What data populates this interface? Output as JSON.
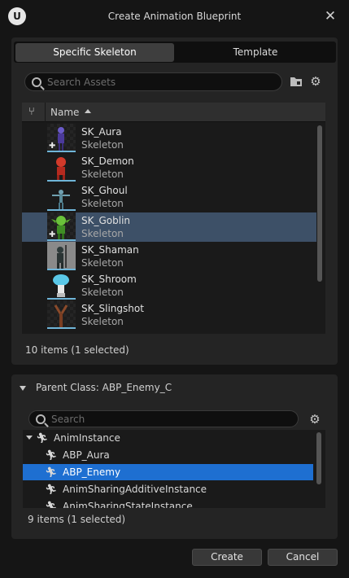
{
  "window": {
    "title": "Create Animation Blueprint",
    "logo_text": "U",
    "close_glyph": "✕"
  },
  "tabs": [
    {
      "label": "Specific Skeleton",
      "active": true
    },
    {
      "label": "Template",
      "active": false
    }
  ],
  "asset_search": {
    "placeholder": "Search Assets",
    "value": ""
  },
  "asset_list": {
    "column_header": "Name",
    "items": [
      {
        "name": "SK_Aura",
        "type": "Skeleton",
        "icon": "aura-character-thumbnail",
        "selected": false
      },
      {
        "name": "SK_Demon",
        "type": "Skeleton",
        "icon": "demon-character-thumbnail",
        "selected": false
      },
      {
        "name": "SK_Ghoul",
        "type": "Skeleton",
        "icon": "ghoul-character-thumbnail",
        "selected": false
      },
      {
        "name": "SK_Goblin",
        "type": "Skeleton",
        "icon": "goblin-character-thumbnail",
        "selected": true
      },
      {
        "name": "SK_Shaman",
        "type": "Skeleton",
        "icon": "shaman-character-thumbnail",
        "selected": false
      },
      {
        "name": "SK_Shroom",
        "type": "Skeleton",
        "icon": "shroom-character-thumbnail",
        "selected": false
      },
      {
        "name": "SK_Slingshot",
        "type": "Skeleton",
        "icon": "slingshot-thumbnail",
        "selected": false
      }
    ],
    "status": "10 items (1 selected)"
  },
  "parent_class": {
    "header": "Parent Class: ABP_Enemy_C",
    "search_placeholder": "Search",
    "tree": [
      {
        "label": "AnimInstance",
        "expanded": true,
        "selected": false
      },
      {
        "label": "ABP_Aura",
        "selected": false
      },
      {
        "label": "ABP_Enemy",
        "selected": true
      },
      {
        "label": "AnimSharingAdditiveInstance",
        "selected": false
      },
      {
        "label": "AnimSharingStateInstance",
        "selected": false
      }
    ],
    "status": "9 items (1 selected)"
  },
  "actions": {
    "create_label": "Create",
    "cancel_label": "Cancel"
  },
  "colors": {
    "selection_blue": "#1e6fd1",
    "selection_slate": "#3d5067",
    "thumbnail_underline": "#6fb5d8"
  }
}
